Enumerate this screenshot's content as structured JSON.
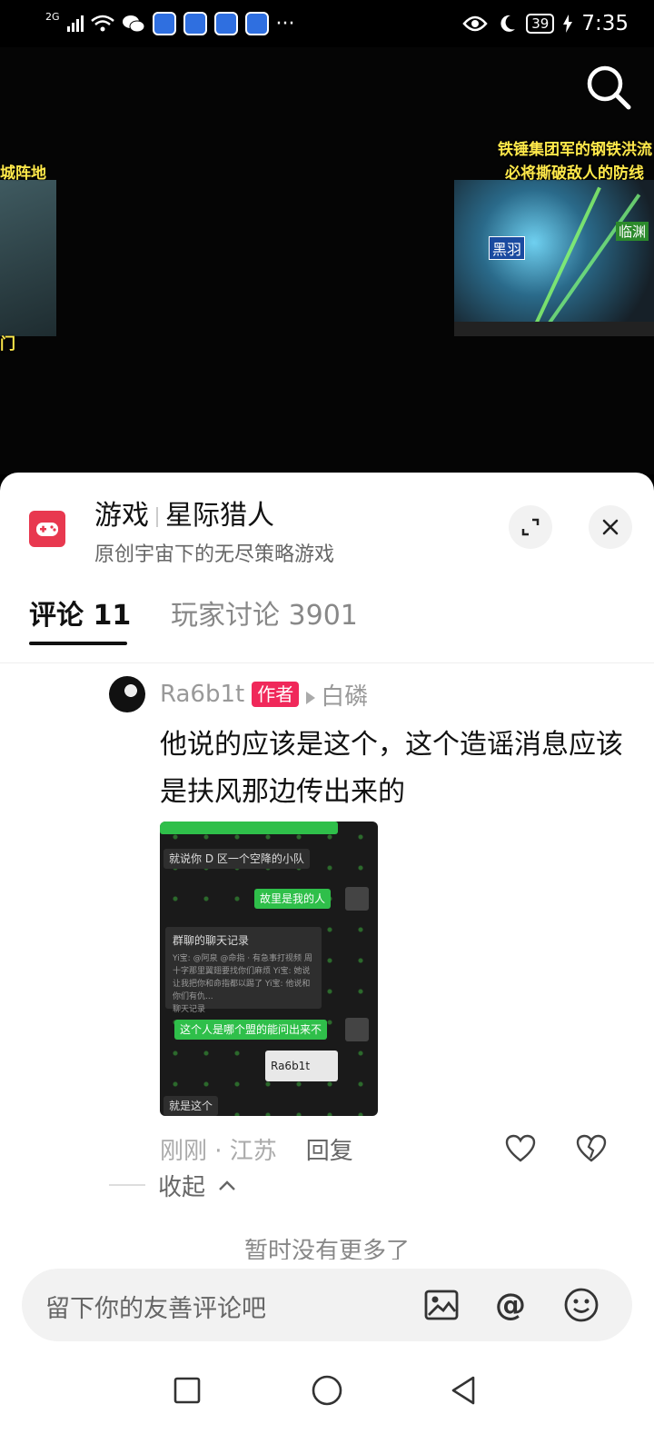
{
  "status_bar": {
    "network": "2G",
    "battery": "39",
    "time": "7:35",
    "more": "···"
  },
  "video": {
    "caption_left_1": "城阵地",
    "caption_left_2": "门",
    "caption_right_1": "铁锤集团军的钢铁洪流",
    "caption_right_2": "必将撕破敌人的防线",
    "thumb_tag_1": "黑羽",
    "thumb_tag_2": "临渊"
  },
  "sheet": {
    "category": "游戏",
    "game_name": "星际猎人",
    "subtitle": "原创宇宙下的无尽策略游戏"
  },
  "tabs": [
    {
      "label": "评论 11",
      "active": true
    },
    {
      "label": "玩家讨论 3901",
      "active": false
    }
  ],
  "comment": {
    "author": "Ra6b1t",
    "badge": "作者",
    "reply_to": "白磷",
    "text": "他说的应该是这个，这个造谣消息应该是扶风那边传出来的",
    "time_location": "刚刚 · 江苏",
    "reply_label": "回复",
    "image": {
      "msg_1": "就说你 D 区一个空降的小队",
      "msg_2": "故里是我的人",
      "record_title": "群聊的聊天记录",
      "record_lines": "Yi宝: @阿泉 @命指 · 有急事打视频 周十字那里翼翅要找你们麻烦 Yi宝: 她说让我把你和命指都以踢了 Yi宝: 他说和你们有仇...",
      "record_footer": "聊天记录",
      "msg_3": "这个人是哪个盟的能问出来不",
      "card_name": "Ra6b1t",
      "msg_4": "就是这个"
    }
  },
  "collapse_label": "收起",
  "no_more": "暂时没有更多了",
  "input": {
    "placeholder": "留下你的友善评论吧",
    "at_symbol": "@"
  },
  "colors": {
    "badge": "#f0285a",
    "game_icon": "#e8384f",
    "chat_green": "#2fbf4a"
  }
}
